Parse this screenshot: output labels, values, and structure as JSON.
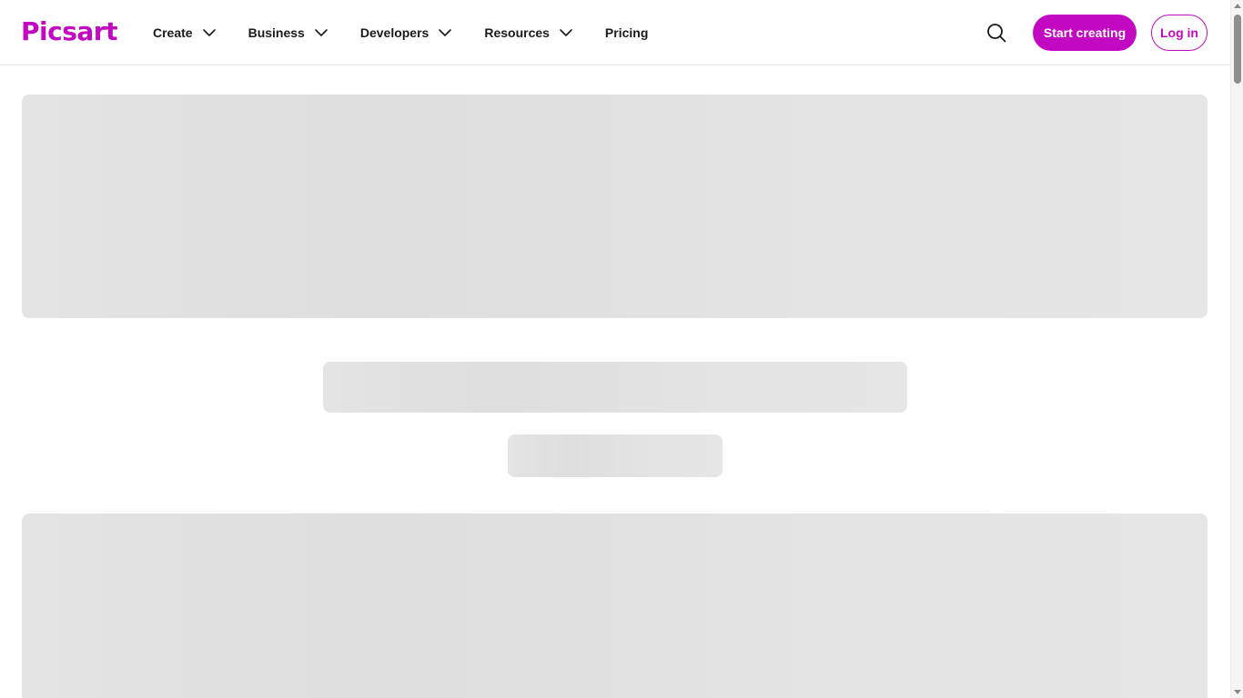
{
  "brand": {
    "logo_text": "Picsart",
    "accent_color": "#c209c1"
  },
  "nav": {
    "items": [
      {
        "label": "Create",
        "has_dropdown": true
      },
      {
        "label": "Business",
        "has_dropdown": true
      },
      {
        "label": "Developers",
        "has_dropdown": true
      },
      {
        "label": "Resources",
        "has_dropdown": true
      },
      {
        "label": "Pricing",
        "has_dropdown": false
      }
    ]
  },
  "header_actions": {
    "search_icon": "search-icon",
    "start_label": "Start creating",
    "login_label": "Log in"
  },
  "content": {
    "state": "loading-skeleton",
    "skeleton_color": "#e2e2e2"
  }
}
